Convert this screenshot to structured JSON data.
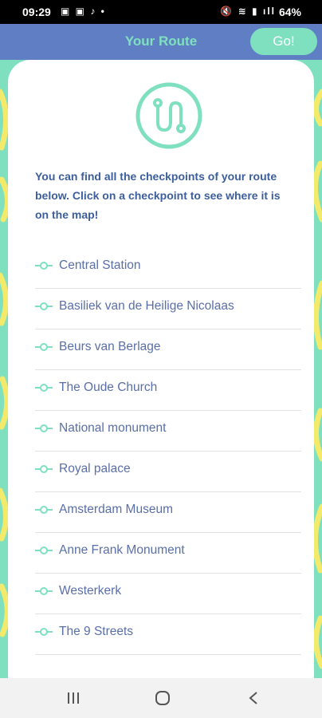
{
  "status_bar": {
    "time": "09:29",
    "battery": "64%"
  },
  "header": {
    "title": "Your Route",
    "go_label": "Go!"
  },
  "intro": "You can find all the checkpoints of your route below. Click on a checkpoint to see where it is on the map!",
  "checkpoints": [
    "Central Station",
    "Basiliek van de Heilige Nicolaas",
    "Beurs van Berlage",
    "The Oude Church",
    "National monument",
    "Royal palace",
    "Amsterdam Museum",
    "Anne Frank Monument",
    "Westerkerk",
    "The 9 Streets"
  ],
  "colors": {
    "header": "#5f7ec3",
    "mint": "#7fe0bf",
    "pattern": "#f3e96b",
    "text": "#3d5e9c"
  },
  "icons": {
    "logo": "route-logo-icon",
    "checkpoint": "checkpoint-node-icon",
    "nav": [
      "recents-icon",
      "home-icon",
      "back-icon"
    ]
  }
}
